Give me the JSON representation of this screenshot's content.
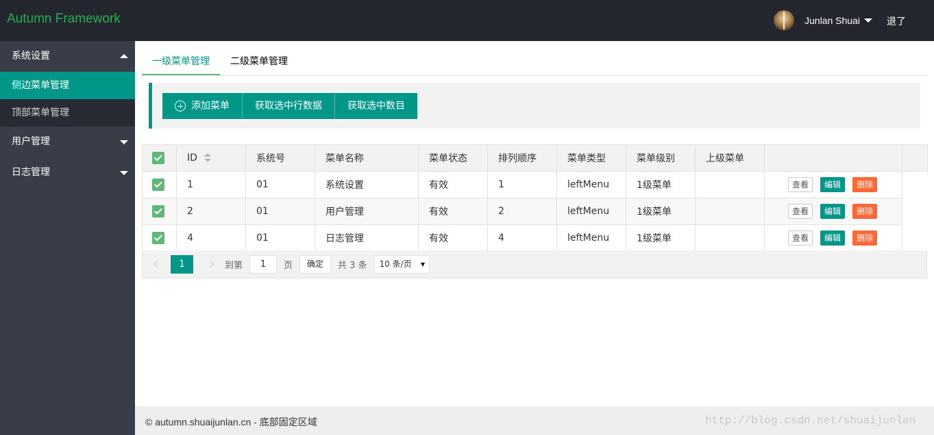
{
  "header": {
    "logo": "Autumn Framework",
    "user_name": "Junlan Shuai",
    "logout": "退了"
  },
  "sidebar": {
    "groups": [
      {
        "label": "系统设置",
        "expanded": true,
        "items": [
          "侧边菜单管理",
          "顶部菜单管理"
        ]
      },
      {
        "label": "用户管理",
        "expanded": false
      },
      {
        "label": "日志管理",
        "expanded": false
      }
    ]
  },
  "tabs": [
    "一级菜单管理",
    "二级菜单管理"
  ],
  "toolbar": {
    "add": "添加菜单",
    "get_rows": "获取选中行数据",
    "get_count": "获取选中数目"
  },
  "table": {
    "columns": [
      "ID",
      "系统号",
      "菜单名称",
      "菜单状态",
      "排列顺序",
      "菜单类型",
      "菜单级别",
      "上级菜单"
    ],
    "rows": [
      [
        "1",
        "01",
        "系统设置",
        "有效",
        "1",
        "leftMenu",
        "1级菜单",
        ""
      ],
      [
        "2",
        "01",
        "用户管理",
        "有效",
        "2",
        "leftMenu",
        "1级菜单",
        ""
      ],
      [
        "4",
        "01",
        "日志管理",
        "有效",
        "4",
        "leftMenu",
        "1级菜单",
        ""
      ]
    ],
    "actions": {
      "view": "查看",
      "edit": "编辑",
      "delete": "删除"
    }
  },
  "pager": {
    "current": "1",
    "goto_label": "到第",
    "page_input": "1",
    "page_unit": "页",
    "confirm": "确定",
    "total": "共 3 条",
    "limit": "10 条/页"
  },
  "footer": {
    "text": "© autumn.shuaijunlan.cn - 底部固定区域",
    "watermark": "http://blog.csdn.net/shuaijunlan"
  },
  "colors": {
    "accent": "#009688",
    "header_bg": "#23262e",
    "sidebar_bg": "#393d49",
    "logo": "#22b14c",
    "checkbox": "#5fb878",
    "delete": "#ff5722"
  }
}
